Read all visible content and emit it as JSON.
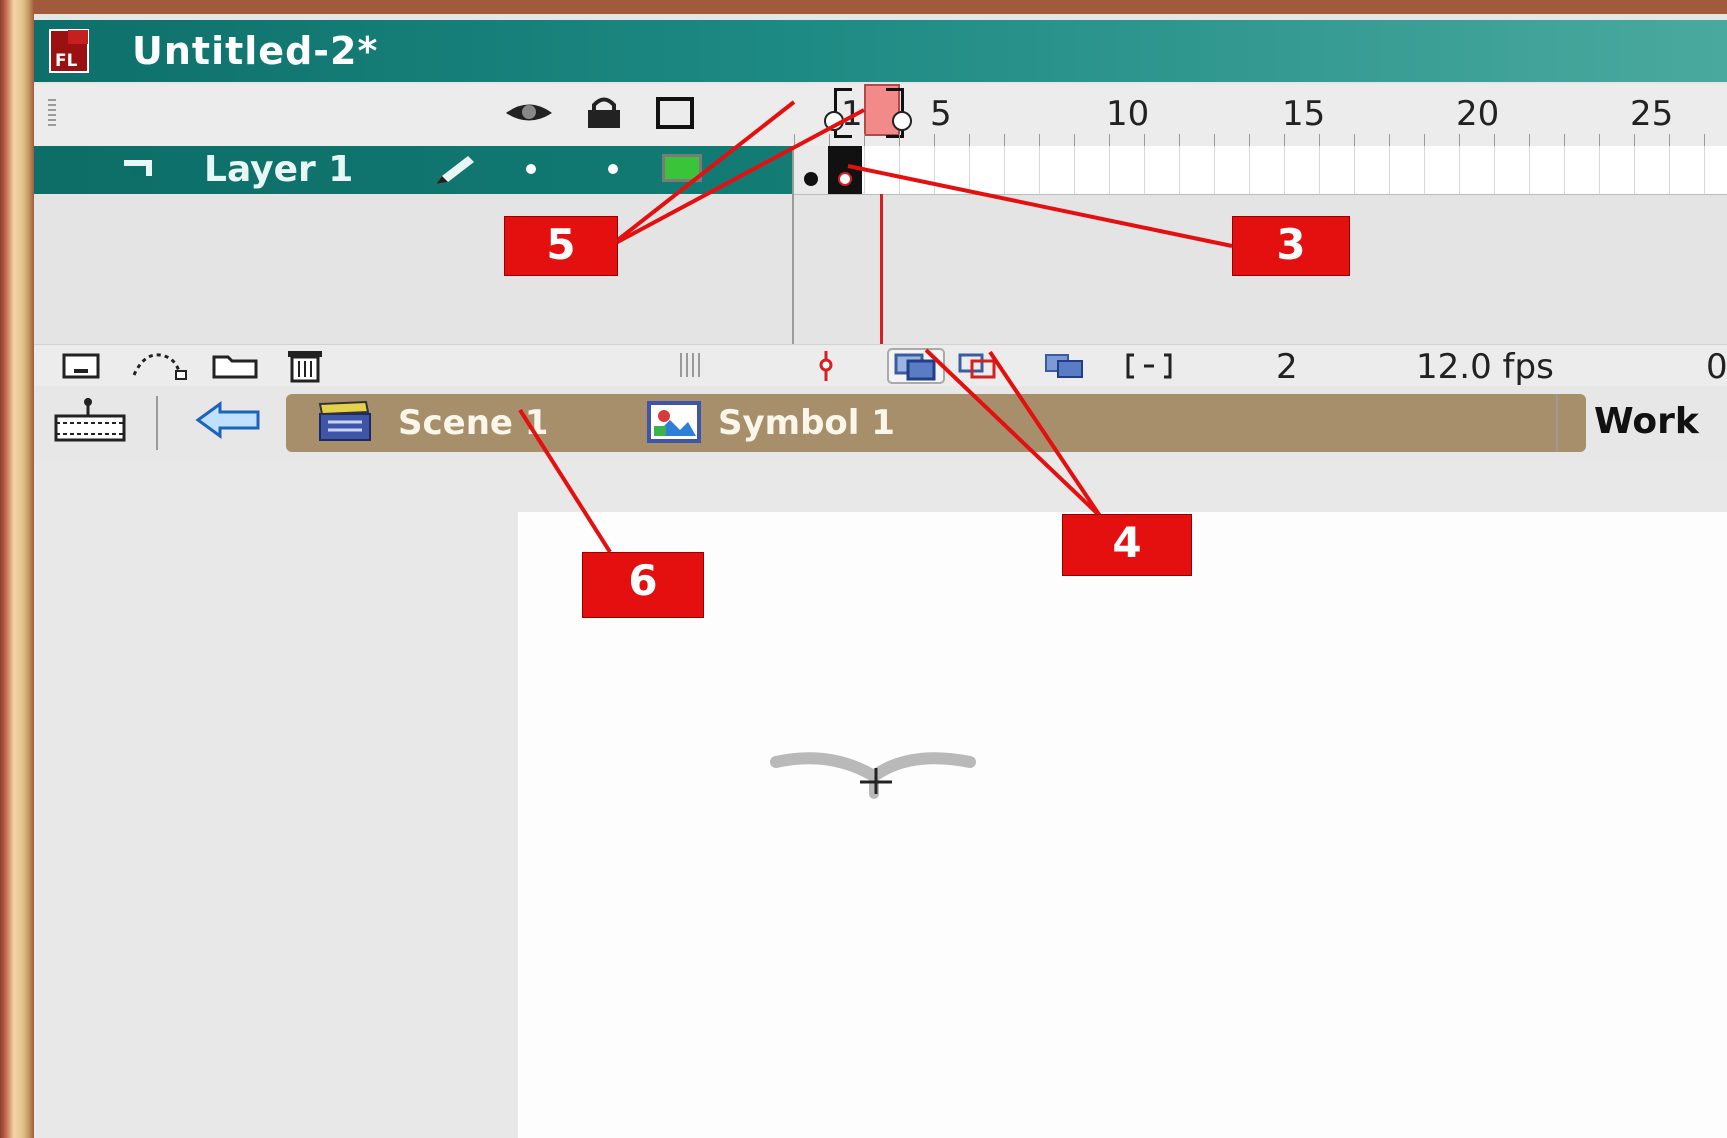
{
  "window": {
    "title": "Untitled-2*",
    "app_icon": "flash-fl-icon"
  },
  "timeline": {
    "header_icons": [
      "eye-icon",
      "lock-icon",
      "outline-square-icon"
    ],
    "ruler_labels": [
      "1",
      "5",
      "10",
      "15",
      "20",
      "25"
    ],
    "current_frame_highlight": "frame 2",
    "layers": [
      {
        "name": "Layer 1",
        "icons": [
          "layer-type-icon",
          "pencil-icon",
          "dot",
          "dot",
          "green-outline-swatch"
        ]
      }
    ],
    "footer": {
      "icons": [
        "new-layer-icon",
        "motion-guide-icon",
        "new-folder-icon",
        "trash-icon"
      ],
      "current_frame": "2",
      "frame_rate": "12.0 fps",
      "elapsed_prefix": "0"
    }
  },
  "edit_bar": {
    "back_icon": "back-arrow-icon",
    "breadcrumbs": [
      {
        "label": "Scene 1",
        "icon": "clapper-icon"
      },
      {
        "label": "Symbol 1",
        "icon": "symbol-icon"
      }
    ],
    "workspace_label": "Work"
  },
  "callouts": [
    "5",
    "3",
    "4",
    "6"
  ],
  "colors": {
    "titlebar": "#127c75",
    "layer_selected": "#0d6d67",
    "breadcrumb_bg": "#a78f6b",
    "callout_red": "#e41010",
    "playhead": "#f28a8a"
  }
}
